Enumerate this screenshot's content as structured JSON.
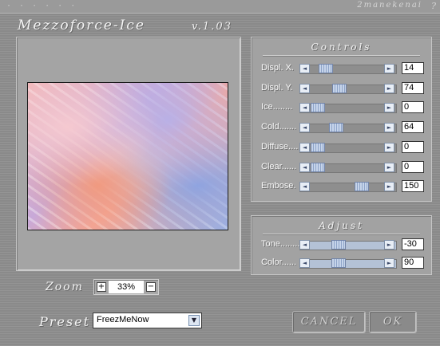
{
  "header": {
    "dots": "· · · · · ·",
    "maker": "2manekenai",
    "help": "?"
  },
  "app": {
    "title": "Mezzoforce-Ice",
    "version": "v.1.03"
  },
  "controls": {
    "title": "Controls",
    "rows": [
      {
        "label": "Displ. X.",
        "value": "14",
        "level": 0.14
      },
      {
        "label": "Displ. Y.",
        "value": "74",
        "level": 0.37
      },
      {
        "label": "Ice........",
        "value": "0",
        "level": 0.0
      },
      {
        "label": "Cold.......",
        "value": "64",
        "level": 0.32
      },
      {
        "label": "Diffuse....",
        "value": "0",
        "level": 0.0
      },
      {
        "label": "Clear......",
        "value": "0",
        "level": 0.0
      },
      {
        "label": "Embose.",
        "value": "150",
        "level": 0.75
      }
    ]
  },
  "adjust": {
    "title": "Adjust",
    "rows": [
      {
        "label": "Tone........",
        "value": "-30",
        "level": 0.35
      },
      {
        "label": "Color......",
        "value": "90",
        "level": 0.35
      }
    ]
  },
  "zoom": {
    "label": "Zoom",
    "value": "33%",
    "plus": "+",
    "minus": "−"
  },
  "preset": {
    "label": "Preset",
    "value": "FreezMeNow",
    "arrow": "▼"
  },
  "buttons": {
    "cancel": "CANCEL",
    "ok": "OK"
  },
  "icons": {
    "left_arrow": "◄",
    "right_arrow": "►"
  }
}
